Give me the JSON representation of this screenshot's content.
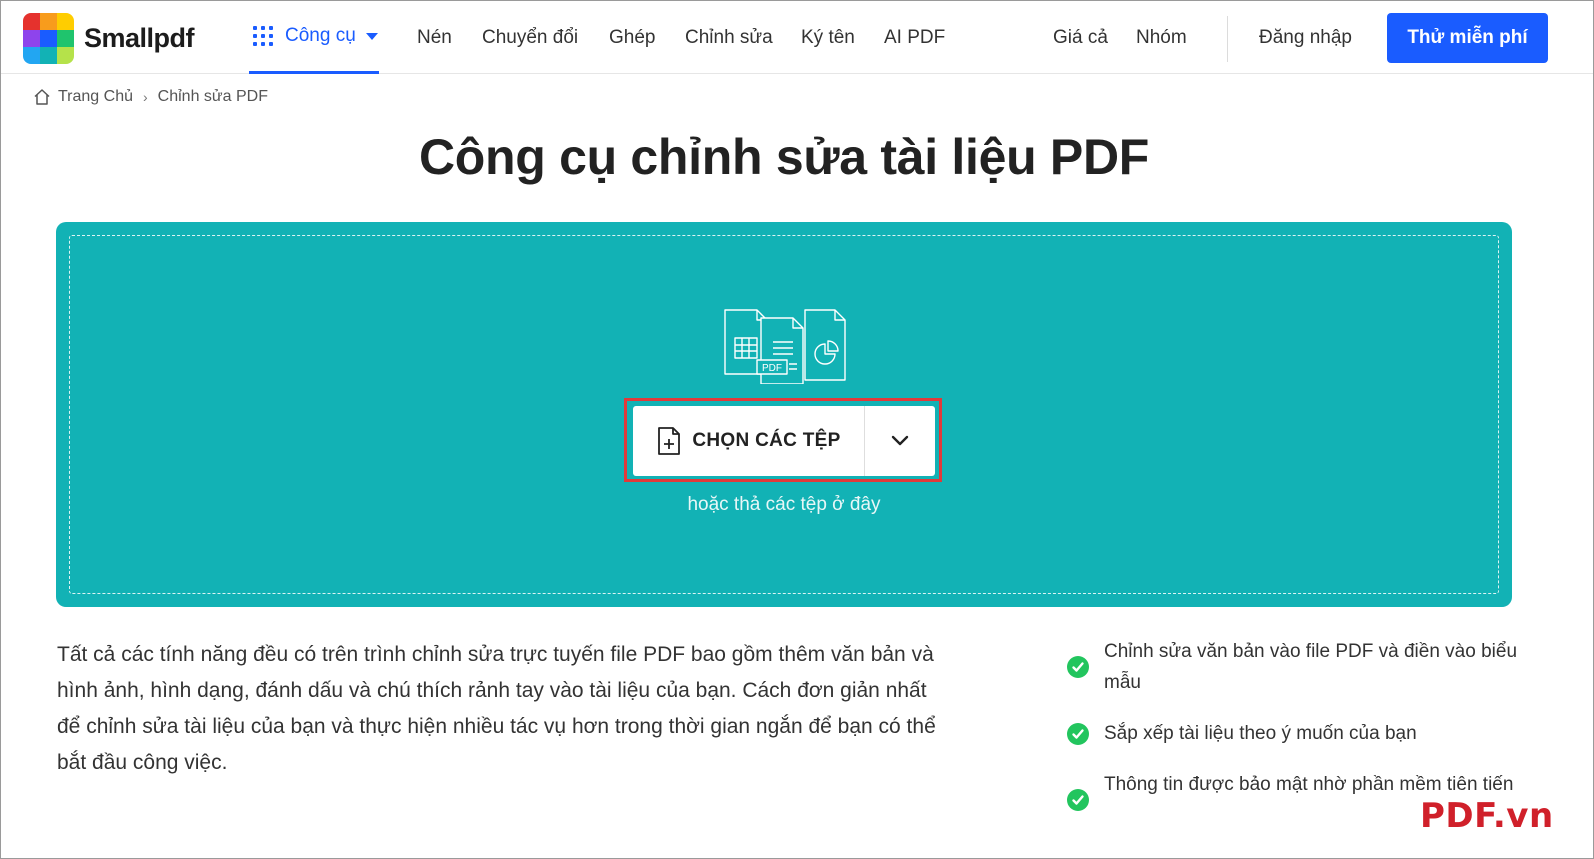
{
  "header": {
    "brand": "Smallpdf",
    "tools_label": "Công cụ",
    "nav": [
      "Nén",
      "Chuyển đổi",
      "Ghép",
      "Chỉnh sửa",
      "Ký tên",
      "AI PDF"
    ],
    "pricing": "Giá cả",
    "team": "Nhóm",
    "login": "Đăng nhập",
    "cta": "Thử miễn phí",
    "accent": "#1a5cff"
  },
  "breadcrumb": {
    "home": "Trang Chủ",
    "current": "Chỉnh sửa PDF"
  },
  "page_title": "Công cụ chỉnh sửa tài liệu PDF",
  "upload": {
    "button_label": "CHỌN CÁC TỆP",
    "drop_hint": "hoặc thả các tệp ở đây",
    "icon_badge": "PDF",
    "background": "#12b2b5",
    "highlight": "#e03a3a"
  },
  "description": "Tất cả các tính năng đều có trên trình chỉnh sửa trực tuyến file PDF bao gồm thêm văn bản và hình ảnh, hình dạng, đánh dấu và chú thích rảnh tay vào tài liệu của bạn. Cách đơn giản nhất để chỉnh sửa tài liệu của bạn và thực hiện nhiều tác vụ hơn trong thời gian ngắn để bạn có thể bắt đầu công việc.",
  "features": [
    "Chỉnh sửa văn bản vào file PDF và điền vào biểu mẫu",
    "Sắp xếp tài liệu theo ý muốn của bạn",
    "Thông tin được bảo mật nhờ phần mềm tiên tiến"
  ],
  "watermark": "PDF.vn"
}
